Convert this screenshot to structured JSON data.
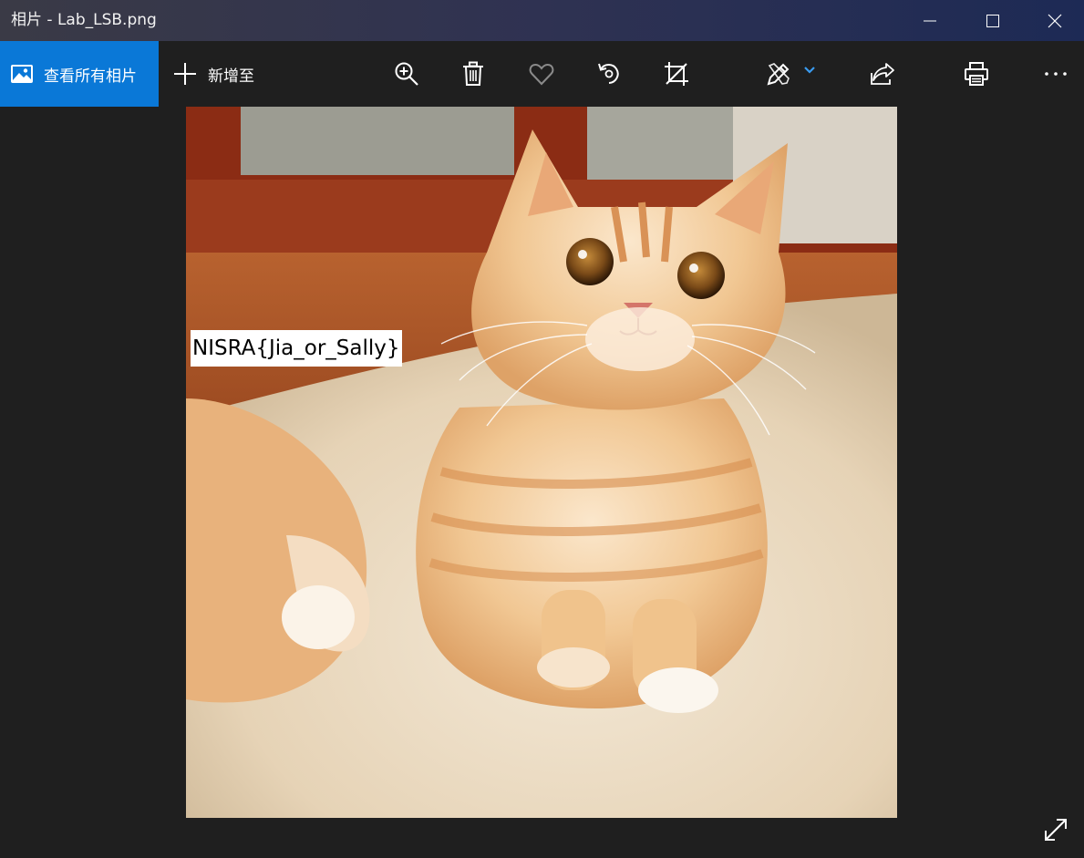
{
  "window": {
    "title": "相片 - Lab_LSB.png"
  },
  "toolbar": {
    "view_all_label": "查看所有相片",
    "add_to_label": "新增至"
  },
  "image": {
    "overlay_text": "NISRA{Jia_or_Sally}"
  },
  "icons": {
    "photos": "photos-icon",
    "add": "plus-icon",
    "zoom": "zoom-in-icon",
    "delete": "trash-icon",
    "favorite": "heart-icon",
    "rotate": "rotate-icon",
    "crop": "crop-icon",
    "edit": "edit-create-icon",
    "share": "share-icon",
    "print": "print-icon",
    "more": "more-icon",
    "fullscreen": "fullscreen-icon"
  },
  "colors": {
    "accent": "#0a78d7",
    "background": "#1f1f1f"
  }
}
